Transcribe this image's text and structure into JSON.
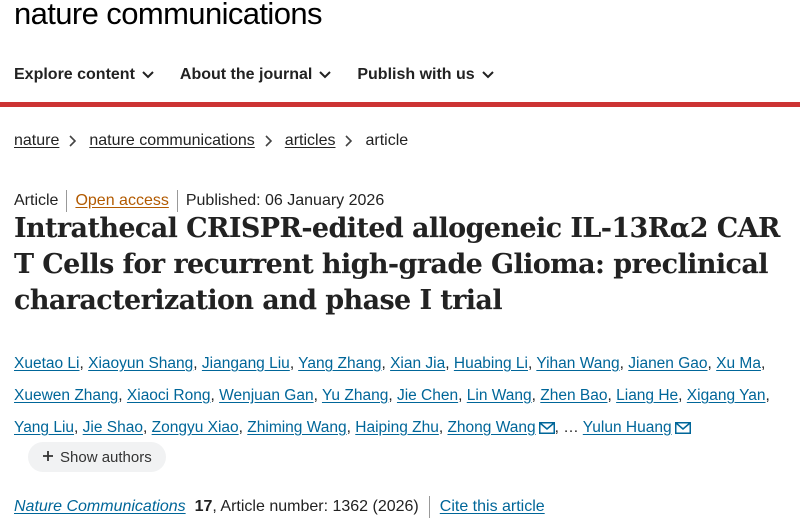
{
  "site": {
    "logo": "nature communications"
  },
  "nav": {
    "items": [
      {
        "label": "Explore content",
        "icon": "chevron-down-icon"
      },
      {
        "label": "About the journal",
        "icon": "chevron-down-icon"
      },
      {
        "label": "Publish with us",
        "icon": "chevron-down-icon"
      }
    ]
  },
  "colors": {
    "accent_rule": "#cc3333",
    "link": "#006699",
    "open_access": "#b25a00"
  },
  "breadcrumb": {
    "items": [
      "nature",
      "nature communications",
      "articles"
    ],
    "current": "article"
  },
  "article": {
    "type": "Article",
    "access": "Open access",
    "published": "Published: 06 January 2026",
    "title": "Intrathecal CRISPR-edited allogeneic IL-13Rα2 CAR T Cells for recurrent high-grade Glioma: preclinical characterization and phase I trial",
    "authors": [
      "Xuetao Li",
      "Xiaoyun Shang",
      "Jiangang Liu",
      "Yang Zhang",
      "Xian Jia",
      "Huabing Li",
      "Yihan Wang",
      "Jianen Gao",
      "Xu Ma",
      "Xuewen Zhang",
      "Xiaoci Rong",
      "Wenjuan Gan",
      "Yu Zhang",
      "Jie Chen",
      "Lin Wang",
      "Zhen Bao",
      "Liang He",
      "Xigang Yan",
      "Yang Liu",
      "Jie Shao",
      "Zongyu Xiao",
      "Zhiming Wang",
      "Haiping Zhu",
      "Zhong Wang"
    ],
    "ellipsis": "…",
    "last_author": "Yulun Huang",
    "show_authors": "Show authors",
    "journal": "Nature Communications",
    "volume": "17",
    "article_number": ", Article number: 1362 (2026)",
    "cite": "Cite this article"
  }
}
